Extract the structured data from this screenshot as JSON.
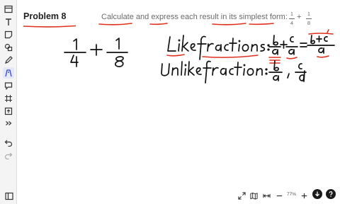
{
  "problem": {
    "title": "Problem 8",
    "prompt_text": "Calculate and express each result in its simplest form:",
    "fraction_a": {
      "numerator": "1",
      "denominator": "4"
    },
    "operator": "+",
    "fraction_b": {
      "numerator": "1",
      "denominator": "8"
    }
  },
  "handwriting": {
    "expression": "1/4 + 1/8",
    "like_fractions": "Like fractions: b/a + c/a = (b+c)/a",
    "unlike_fractions": "Unlike fraction: b/a , c/d",
    "ink_color": "#111111",
    "highlight_color": "#e0301e"
  },
  "toolbar": {
    "tools": [
      "panel-icon",
      "text-icon",
      "sticky-note-icon",
      "shapes-icon",
      "pen-icon",
      "highlighter-icon",
      "comment-icon",
      "frame-icon",
      "upload-icon",
      "more-icon",
      "undo-icon",
      "redo-icon"
    ]
  },
  "bottom": {
    "zoom": "77%",
    "sidebar_icon": "sidebar-icon",
    "controls": [
      "fit-screen-icon",
      "map-icon",
      "fit-width-icon",
      "zoom-out-icon",
      "zoom-in-icon",
      "download-icon",
      "help-icon"
    ]
  },
  "colors": {
    "accent": "#e0301e",
    "toolbar_bg": "#f4f4f5",
    "fab": "#1a1a1a"
  }
}
